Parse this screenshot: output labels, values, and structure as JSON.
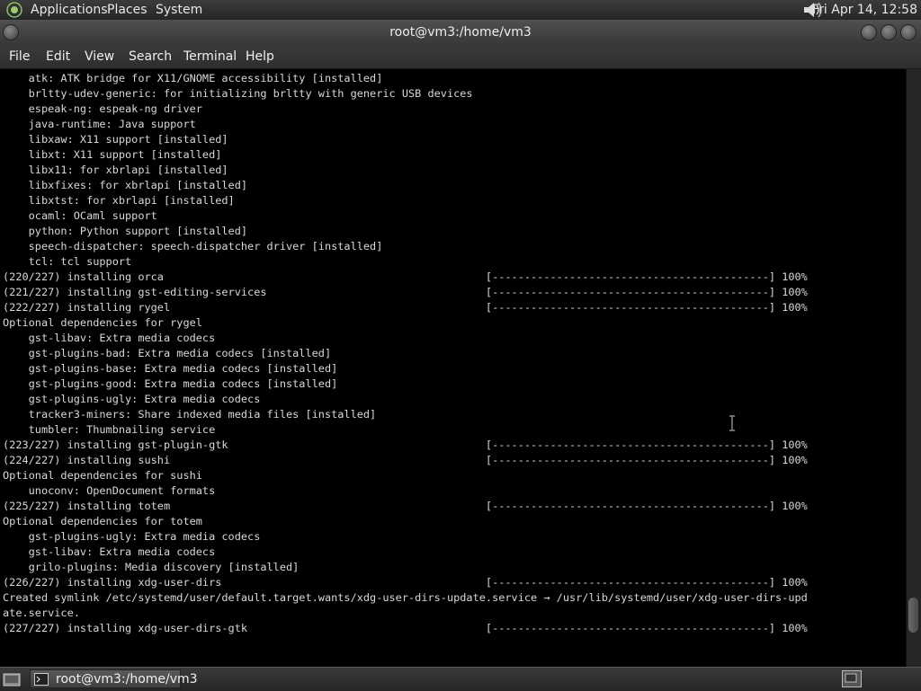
{
  "top_panel": {
    "menus": [
      "Applications",
      "Places",
      "System"
    ],
    "clock": "Fri Apr 14, 12:58",
    "icons": {
      "logo": "gnome-foot-icon",
      "volume": "speaker-icon"
    }
  },
  "window": {
    "title": "root@vm3:/home/vm3",
    "menu": [
      "File",
      "Edit",
      "View",
      "Search",
      "Terminal",
      "Help"
    ]
  },
  "terminal": {
    "lines": [
      "    atk: ATK bridge for X11/GNOME accessibility [installed]",
      "    brltty-udev-generic: for initializing brltty with generic USB devices",
      "    espeak-ng: espeak-ng driver",
      "    java-runtime: Java support",
      "    libxaw: X11 support [installed]",
      "    libxt: X11 support [installed]",
      "    libx11: for xbrlapi [installed]",
      "    libxfixes: for xbrlapi [installed]",
      "    libxtst: for xbrlapi [installed]",
      "    ocaml: OCaml support",
      "    python: Python support [installed]",
      "    speech-dispatcher: speech-dispatcher driver [installed]",
      "    tcl: tcl support",
      "(220/227) installing orca                                                  [-------------------------------------------] 100%",
      "(221/227) installing gst-editing-services                                  [-------------------------------------------] 100%",
      "(222/227) installing rygel                                                 [-------------------------------------------] 100%",
      "Optional dependencies for rygel",
      "    gst-libav: Extra media codecs",
      "    gst-plugins-bad: Extra media codecs [installed]",
      "    gst-plugins-base: Extra media codecs [installed]",
      "    gst-plugins-good: Extra media codecs [installed]",
      "    gst-plugins-ugly: Extra media codecs",
      "    tracker3-miners: Share indexed media files [installed]",
      "    tumbler: Thumbnailing service",
      "(223/227) installing gst-plugin-gtk                                        [-------------------------------------------] 100%",
      "(224/227) installing sushi                                                 [-------------------------------------------] 100%",
      "Optional dependencies for sushi",
      "    unoconv: OpenDocument formats",
      "(225/227) installing totem                                                 [-------------------------------------------] 100%",
      "Optional dependencies for totem",
      "    gst-plugins-ugly: Extra media codecs",
      "    gst-libav: Extra media codecs",
      "    grilo-plugins: Media discovery [installed]",
      "(226/227) installing xdg-user-dirs                                         [-------------------------------------------] 100%",
      "Created symlink /etc/systemd/user/default.target.wants/xdg-user-dirs-update.service → /usr/lib/systemd/user/xdg-user-dirs-upd",
      "ate.service.",
      "(227/227) installing xdg-user-dirs-gtk                                     [-------------------------------------------] 100%"
    ],
    "scroll_position": 0.94,
    "scroll_visible_fraction": 0.06
  },
  "bottom_panel": {
    "task_label": "root@vm3:/home/vm3",
    "icons": {
      "desktop": "show-desktop-icon",
      "task": "terminal-icon",
      "workspace": "workspace-switcher-icon"
    }
  }
}
